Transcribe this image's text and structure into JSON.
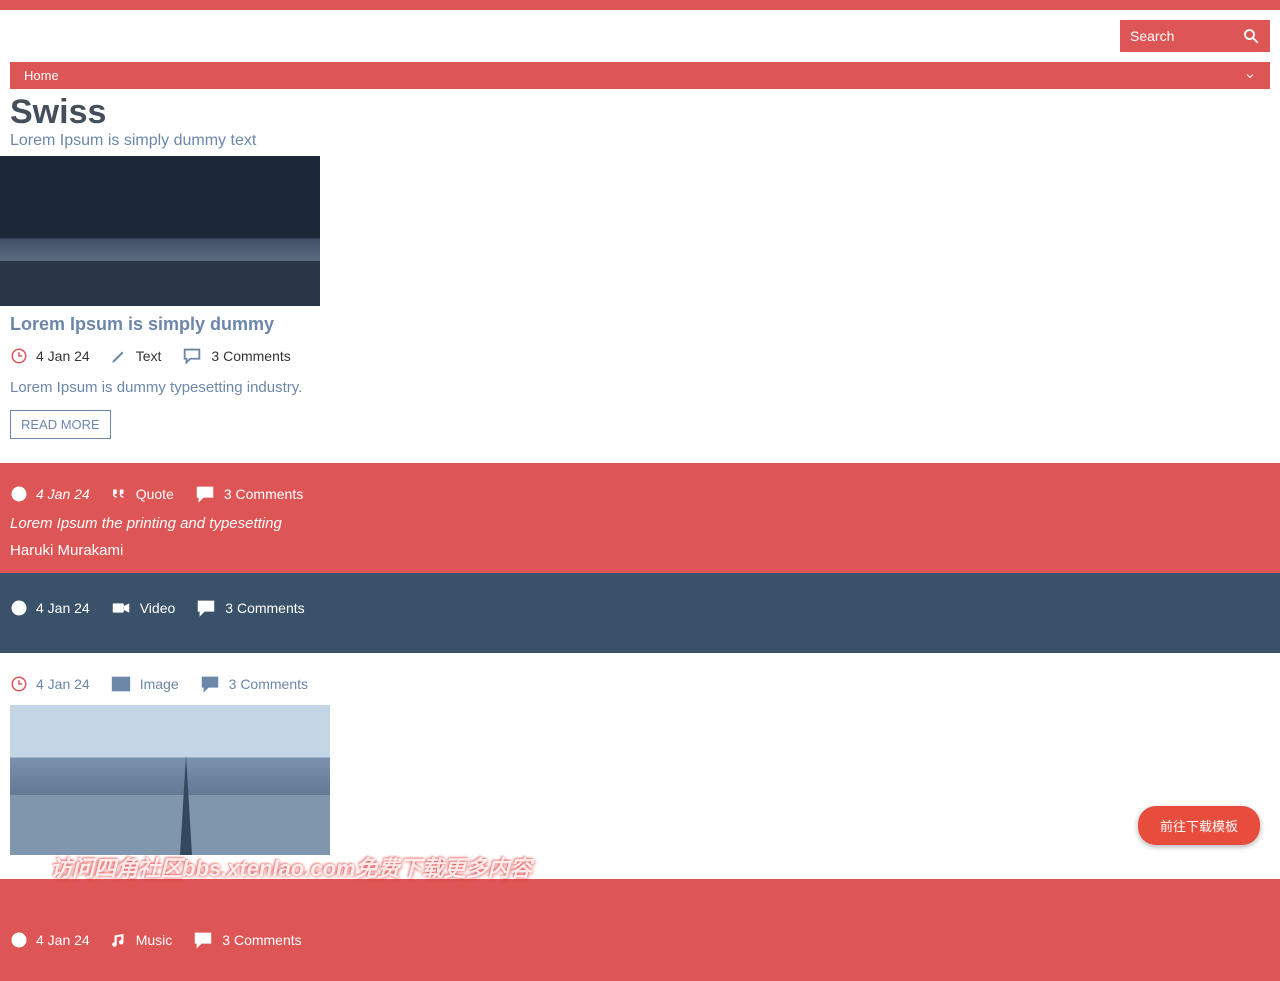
{
  "search": {
    "placeholder": "Search"
  },
  "nav": {
    "home": "Home"
  },
  "site": {
    "title": "Swiss",
    "subtitle": "Lorem Ipsum is simply dummy text"
  },
  "post1": {
    "title": "Lorem Ipsum is simply dummy",
    "date": "4 Jan 24",
    "type": "Text",
    "comments": "3 Comments",
    "excerpt": "Lorem Ipsum is dummy typesetting industry.",
    "read_more": "READ MORE"
  },
  "post2": {
    "date": "4 Jan 24",
    "type": "Quote",
    "comments": "3 Comments",
    "quote": "Lorem Ipsum the printing and typesetting",
    "author": "Haruki Murakami"
  },
  "post3": {
    "date": "4 Jan 24",
    "type": "Video",
    "comments": "3 Comments"
  },
  "post4": {
    "date": "4 Jan 24",
    "type": "Image",
    "comments": "3 Comments"
  },
  "post5": {
    "date": "4 Jan 24",
    "type": "Music",
    "comments": "3 Comments"
  },
  "download_btn": "前往下载模板",
  "watermark": "访问四角社区bbs.xtenlao.com免费下载更多内容"
}
